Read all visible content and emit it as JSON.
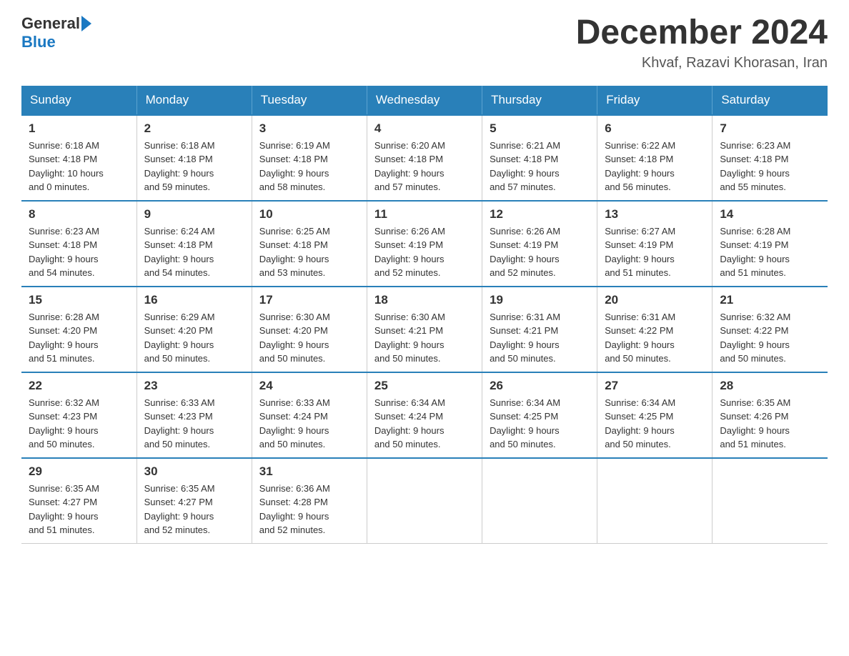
{
  "header": {
    "title": "December 2024",
    "subtitle": "Khvaf, Razavi Khorasan, Iran",
    "logo_line1": "General",
    "logo_line2": "Blue"
  },
  "weekdays": [
    "Sunday",
    "Monday",
    "Tuesday",
    "Wednesday",
    "Thursday",
    "Friday",
    "Saturday"
  ],
  "weeks": [
    [
      {
        "day": "1",
        "sunrise": "6:18 AM",
        "sunset": "4:18 PM",
        "daylight": "10 hours and 0 minutes."
      },
      {
        "day": "2",
        "sunrise": "6:18 AM",
        "sunset": "4:18 PM",
        "daylight": "9 hours and 59 minutes."
      },
      {
        "day": "3",
        "sunrise": "6:19 AM",
        "sunset": "4:18 PM",
        "daylight": "9 hours and 58 minutes."
      },
      {
        "day": "4",
        "sunrise": "6:20 AM",
        "sunset": "4:18 PM",
        "daylight": "9 hours and 57 minutes."
      },
      {
        "day": "5",
        "sunrise": "6:21 AM",
        "sunset": "4:18 PM",
        "daylight": "9 hours and 57 minutes."
      },
      {
        "day": "6",
        "sunrise": "6:22 AM",
        "sunset": "4:18 PM",
        "daylight": "9 hours and 56 minutes."
      },
      {
        "day": "7",
        "sunrise": "6:23 AM",
        "sunset": "4:18 PM",
        "daylight": "9 hours and 55 minutes."
      }
    ],
    [
      {
        "day": "8",
        "sunrise": "6:23 AM",
        "sunset": "4:18 PM",
        "daylight": "9 hours and 54 minutes."
      },
      {
        "day": "9",
        "sunrise": "6:24 AM",
        "sunset": "4:18 PM",
        "daylight": "9 hours and 54 minutes."
      },
      {
        "day": "10",
        "sunrise": "6:25 AM",
        "sunset": "4:18 PM",
        "daylight": "9 hours and 53 minutes."
      },
      {
        "day": "11",
        "sunrise": "6:26 AM",
        "sunset": "4:19 PM",
        "daylight": "9 hours and 52 minutes."
      },
      {
        "day": "12",
        "sunrise": "6:26 AM",
        "sunset": "4:19 PM",
        "daylight": "9 hours and 52 minutes."
      },
      {
        "day": "13",
        "sunrise": "6:27 AM",
        "sunset": "4:19 PM",
        "daylight": "9 hours and 51 minutes."
      },
      {
        "day": "14",
        "sunrise": "6:28 AM",
        "sunset": "4:19 PM",
        "daylight": "9 hours and 51 minutes."
      }
    ],
    [
      {
        "day": "15",
        "sunrise": "6:28 AM",
        "sunset": "4:20 PM",
        "daylight": "9 hours and 51 minutes."
      },
      {
        "day": "16",
        "sunrise": "6:29 AM",
        "sunset": "4:20 PM",
        "daylight": "9 hours and 50 minutes."
      },
      {
        "day": "17",
        "sunrise": "6:30 AM",
        "sunset": "4:20 PM",
        "daylight": "9 hours and 50 minutes."
      },
      {
        "day": "18",
        "sunrise": "6:30 AM",
        "sunset": "4:21 PM",
        "daylight": "9 hours and 50 minutes."
      },
      {
        "day": "19",
        "sunrise": "6:31 AM",
        "sunset": "4:21 PM",
        "daylight": "9 hours and 50 minutes."
      },
      {
        "day": "20",
        "sunrise": "6:31 AM",
        "sunset": "4:22 PM",
        "daylight": "9 hours and 50 minutes."
      },
      {
        "day": "21",
        "sunrise": "6:32 AM",
        "sunset": "4:22 PM",
        "daylight": "9 hours and 50 minutes."
      }
    ],
    [
      {
        "day": "22",
        "sunrise": "6:32 AM",
        "sunset": "4:23 PM",
        "daylight": "9 hours and 50 minutes."
      },
      {
        "day": "23",
        "sunrise": "6:33 AM",
        "sunset": "4:23 PM",
        "daylight": "9 hours and 50 minutes."
      },
      {
        "day": "24",
        "sunrise": "6:33 AM",
        "sunset": "4:24 PM",
        "daylight": "9 hours and 50 minutes."
      },
      {
        "day": "25",
        "sunrise": "6:34 AM",
        "sunset": "4:24 PM",
        "daylight": "9 hours and 50 minutes."
      },
      {
        "day": "26",
        "sunrise": "6:34 AM",
        "sunset": "4:25 PM",
        "daylight": "9 hours and 50 minutes."
      },
      {
        "day": "27",
        "sunrise": "6:34 AM",
        "sunset": "4:25 PM",
        "daylight": "9 hours and 50 minutes."
      },
      {
        "day": "28",
        "sunrise": "6:35 AM",
        "sunset": "4:26 PM",
        "daylight": "9 hours and 51 minutes."
      }
    ],
    [
      {
        "day": "29",
        "sunrise": "6:35 AM",
        "sunset": "4:27 PM",
        "daylight": "9 hours and 51 minutes."
      },
      {
        "day": "30",
        "sunrise": "6:35 AM",
        "sunset": "4:27 PM",
        "daylight": "9 hours and 52 minutes."
      },
      {
        "day": "31",
        "sunrise": "6:36 AM",
        "sunset": "4:28 PM",
        "daylight": "9 hours and 52 minutes."
      },
      null,
      null,
      null,
      null
    ]
  ],
  "labels": {
    "sunrise": "Sunrise:",
    "sunset": "Sunset:",
    "daylight": "Daylight:"
  }
}
